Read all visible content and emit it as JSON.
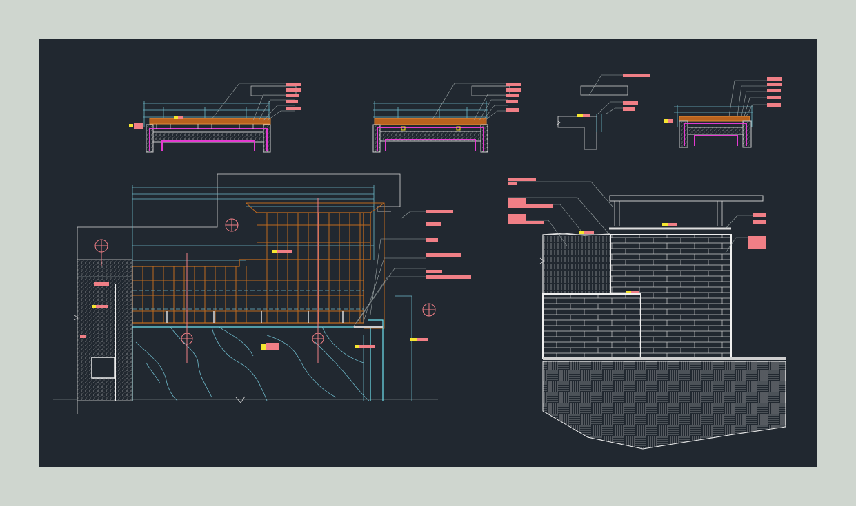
{
  "drawing": {
    "views": [
      {
        "name": "section-1"
      },
      {
        "name": "section-2"
      },
      {
        "name": "detail-small"
      },
      {
        "name": "section-3"
      },
      {
        "name": "plan-deck"
      },
      {
        "name": "elevation-wall"
      }
    ],
    "colors": {
      "background": "#212830",
      "frame": "#cfd6cf",
      "annotation_tag": "#f07f86",
      "dimension": "#6db8c9",
      "wood": "#c06a1e",
      "membrane": "#e33ad0",
      "water_edge": "#6fe3f0",
      "marker": "#f5e630",
      "linework": "#d8d8d8"
    }
  }
}
